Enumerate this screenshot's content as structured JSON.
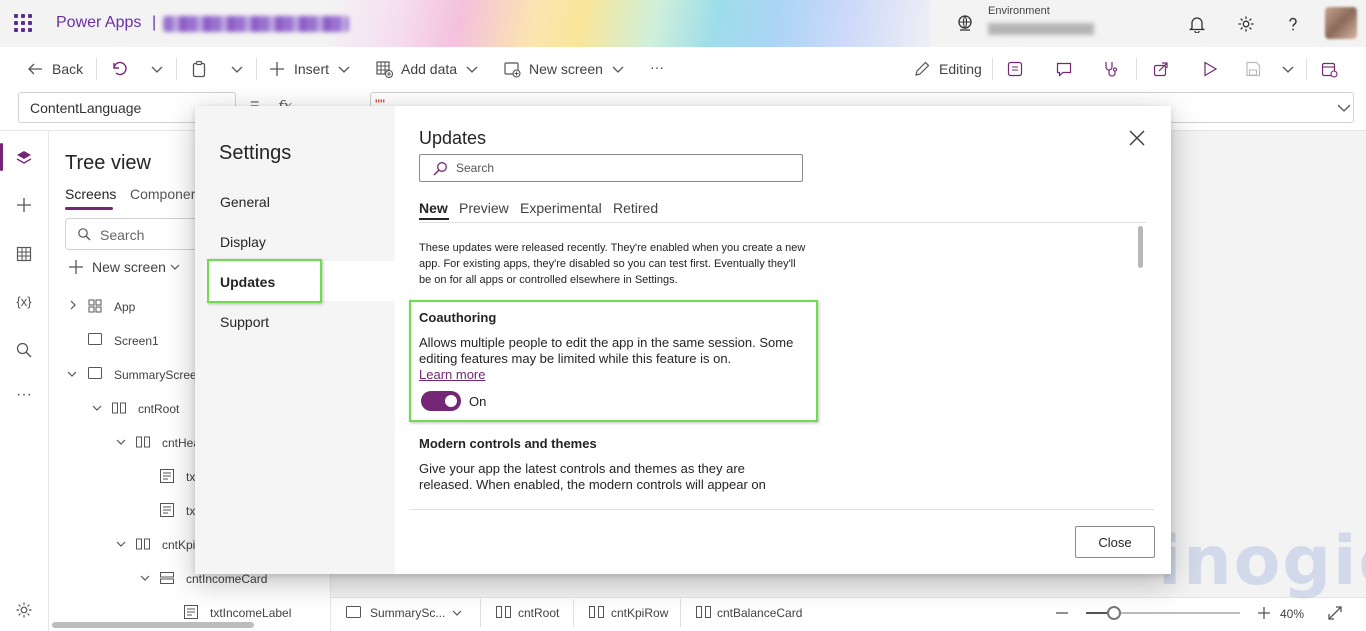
{
  "header": {
    "app_name": "Power Apps",
    "separator": "|",
    "environment_label": "Environment"
  },
  "toolbar": {
    "back": "Back",
    "insert": "Insert",
    "add_data": "Add data",
    "new_screen": "New screen",
    "more": "···",
    "editing": "Editing"
  },
  "formula_bar": {
    "property": "ContentLanguage",
    "fx": "fx",
    "equals": "=",
    "value": "\"\""
  },
  "tree": {
    "title": "Tree view",
    "tabs": [
      "Screens",
      "Componer"
    ],
    "search_placeholder": "Search",
    "new_screen": "New screen",
    "nodes": {
      "app": "App",
      "screen1": "Screen1",
      "summary": "SummaryScreen",
      "cntRoot": "cntRoot",
      "cntHea": "cntHea",
      "tx1": "tx",
      "tx2": "tx",
      "cntKpi": "cntKpi",
      "cntIncomeCard": "cntIncomeCard",
      "txtIncomeLabel": "txtIncomeLabel"
    }
  },
  "breadcrumb": [
    "SummarySc...",
    "cntRoot",
    "cntKpiRow",
    "cntBalanceCard"
  ],
  "zoom": {
    "value": "40%",
    "level": 0.18
  },
  "watermark": "inogic",
  "settings_dialog": {
    "title": "Settings",
    "nav": [
      "General",
      "Display",
      "Updates",
      "Support"
    ],
    "selected": "Updates",
    "section_title": "Updates",
    "search_placeholder": "Search",
    "tabs": [
      "New",
      "Preview",
      "Experimental",
      "Retired"
    ],
    "active_tab": "New",
    "description": "These updates were released recently. They're enabled when you create a new app. For existing apps, they're disabled so you can test first. Eventually they'll be on for all apps or controlled elsewhere in Settings.",
    "features": [
      {
        "title": "Coauthoring",
        "description": "Allows multiple people to edit the app in the same session. Some editing features may be limited while this feature is on.",
        "link": "Learn more",
        "toggle_label": "On",
        "enabled": true
      },
      {
        "title": "Modern controls and themes",
        "description": "Give your app the latest controls and themes as they are released. When enabled, the modern controls will appear on"
      }
    ],
    "close_button": "Close"
  },
  "colors": {
    "brand": "#742774",
    "highlight": "#6ddc4f",
    "formula_string": "#c42b1c"
  }
}
